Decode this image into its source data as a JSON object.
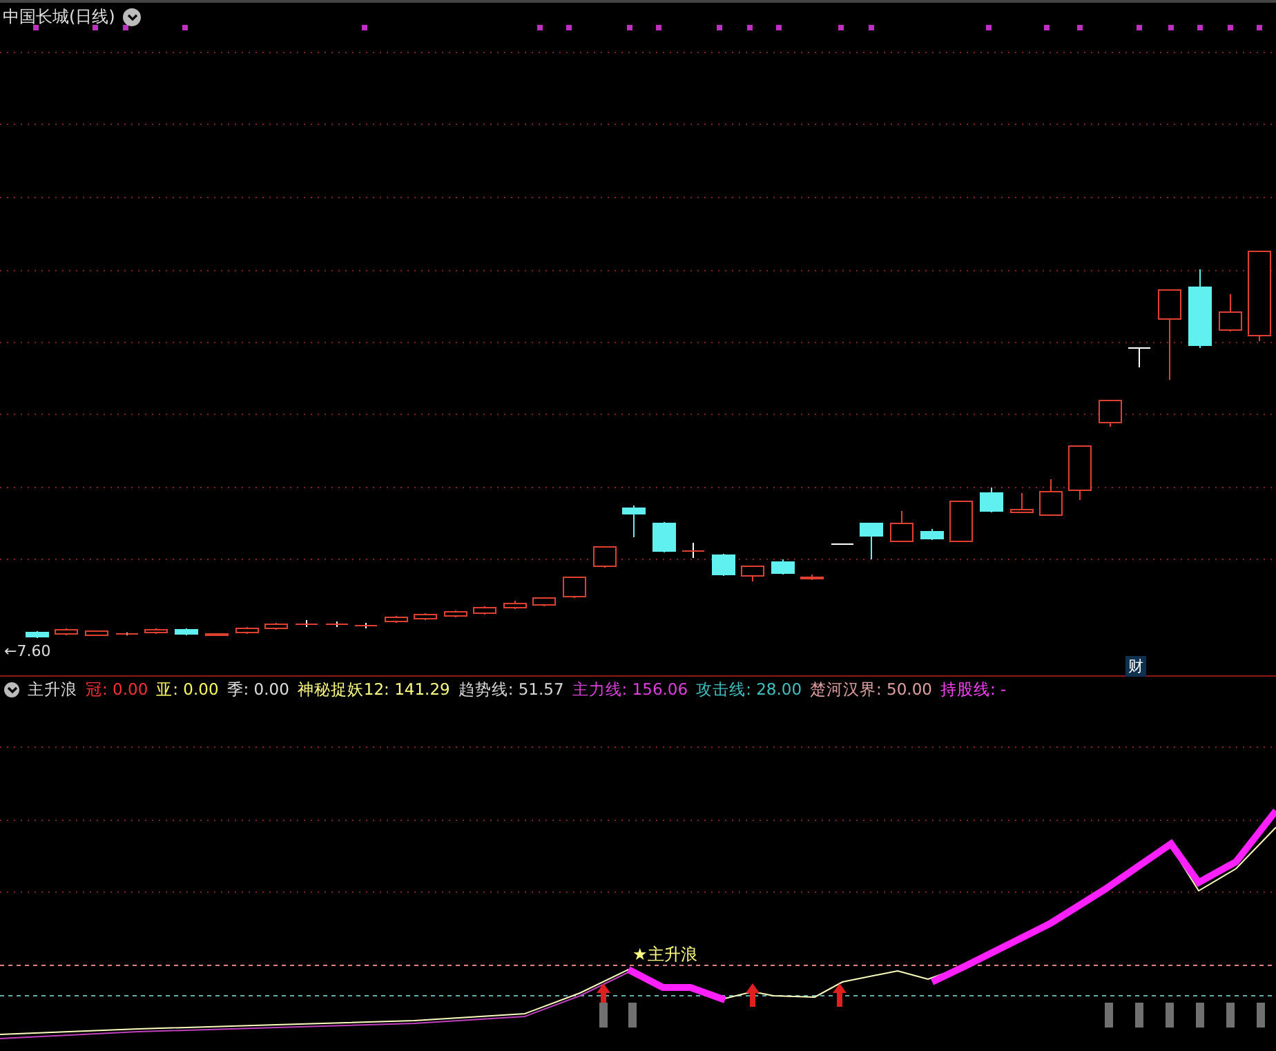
{
  "price_panel": {
    "title": "中国长城(日线)",
    "low_marker": "←7.60",
    "event_marker": "财"
  },
  "indicator_panel": {
    "name": "主升浪",
    "legend": [
      {
        "text": "冠: 0.00",
        "color": "#ff3030"
      },
      {
        "text": "亚: 0.00",
        "color": "#ffff60"
      },
      {
        "text": "季: 0.00",
        "color": "#e0e0e0"
      },
      {
        "text": "神秘捉妖12: 141.29",
        "color": "#ffff80"
      },
      {
        "text": "趋势线: 51.57",
        "color": "#d8d8d8"
      },
      {
        "text": "主力线: 156.06",
        "color": "#e040e0"
      },
      {
        "text": "攻击线: 28.00",
        "color": "#40c0c0"
      },
      {
        "text": "楚河汉界: 50.00",
        "color": "#e0a0a0"
      },
      {
        "text": "持股线: -",
        "color": "#ff40ff"
      }
    ],
    "signal_label": "★主升浪"
  }
}
